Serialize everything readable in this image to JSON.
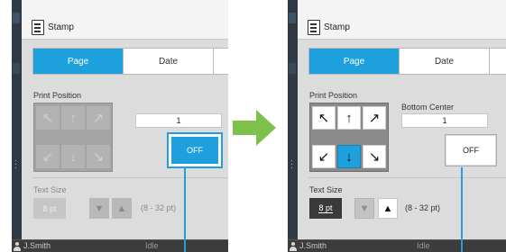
{
  "before": {
    "title": "Stamp",
    "tabs": [
      {
        "label": "Page"
      },
      {
        "label": "Date"
      }
    ],
    "print_position_label": "Print Position",
    "position_name": "",
    "value": "1",
    "off_label": "OFF",
    "text_size_label": "Text Size",
    "size_value": "8 pt",
    "size_range": "(8 - 32 pt)",
    "user": "J.Smith",
    "status": "Idle"
  },
  "after": {
    "title": "Stamp",
    "tabs": [
      {
        "label": "Page"
      },
      {
        "label": "Date"
      }
    ],
    "print_position_label": "Print Position",
    "position_name": "Bottom Center",
    "value": "1",
    "off_label": "OFF",
    "text_size_label": "Text Size",
    "size_value": "8 pt",
    "size_range": "(8 - 32 pt)",
    "user": "J.Smith",
    "status": "Idle"
  },
  "arrows": [
    "↖",
    "↑",
    "↗",
    "↙",
    "↓",
    "↘"
  ],
  "spin_down": "▼",
  "spin_up": "▲",
  "selected_position": "bottom-center",
  "colors": {
    "accent": "#1ea0dc",
    "transition_arrow": "#7dc04b"
  }
}
